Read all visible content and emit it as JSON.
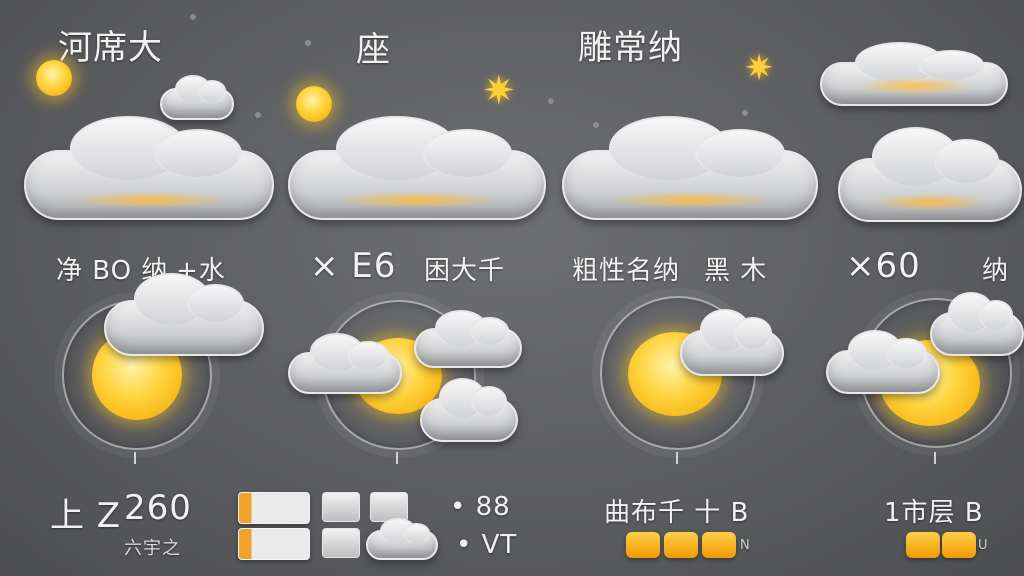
{
  "top_labels": [
    "河席大",
    "座",
    "雕常纳"
  ],
  "panels": [
    {
      "left_text": "净 BO 纳",
      "right_text": "+水",
      "bottom_top": "上 Z",
      "bottom_value": "260",
      "bottom_small": "六宇之"
    },
    {
      "left_text": "× E6",
      "right_text": "困大千",
      "bottom_value": "• 88",
      "bottom_small": "• VT"
    },
    {
      "left_text": "粗性名纳",
      "right_text": "黑 木",
      "bottom_top": "曲布千 十 B",
      "bottom_small": "N"
    },
    {
      "left_text": "×60",
      "right_text": "纳",
      "bottom_top": "1市层 B",
      "bottom_small": "U"
    }
  ],
  "icons": {
    "sun": "sun-icon",
    "cloud": "cloud-icon",
    "star": "star-icon"
  },
  "colors": {
    "background": "#5c5d60",
    "sun": "#ffd23a",
    "accent": "#f29a00"
  }
}
